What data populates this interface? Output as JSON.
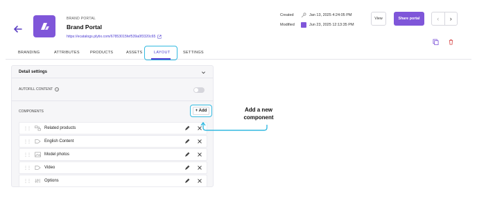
{
  "header": {
    "eyebrow": "BRAND PORTAL",
    "title": "Brand Portal",
    "link": "https://ecatalogs.plytix.com/67853015fef539a0f3320c65",
    "created_label": "Created",
    "created_value": "Jan 13, 2025 4:24:05 PM",
    "modified_label": "Modified",
    "modified_value": "Jun 23, 2025 12:13:35 PM",
    "view_label": "View",
    "share_label": "Share portal"
  },
  "tabs": [
    "BRANDING",
    "ATTRIBUTES",
    "PRODUCTS",
    "ASSETS",
    "LAYOUT",
    "SETTINGS"
  ],
  "active_tab": "LAYOUT",
  "panel": {
    "title": "Detail settings",
    "autofill_label": "AUTOFILL CONTENT",
    "autofill_enabled": false,
    "components_label": "COMPONENTS",
    "add_label": "Add",
    "components": [
      {
        "label": "Related products",
        "icon": "related-products-icon"
      },
      {
        "label": "English Content",
        "icon": "tag-icon"
      },
      {
        "label": "Model photos",
        "icon": "image-icon"
      },
      {
        "label": "Video",
        "icon": "tag-icon"
      },
      {
        "label": "Options",
        "icon": "options-icon"
      }
    ]
  },
  "annotation": {
    "line1": "Add a new",
    "line2": "component"
  },
  "colors": {
    "accent": "#7f56d9",
    "highlight": "#32b9e0",
    "link": "#4b3bd1",
    "danger": "#d64545"
  }
}
